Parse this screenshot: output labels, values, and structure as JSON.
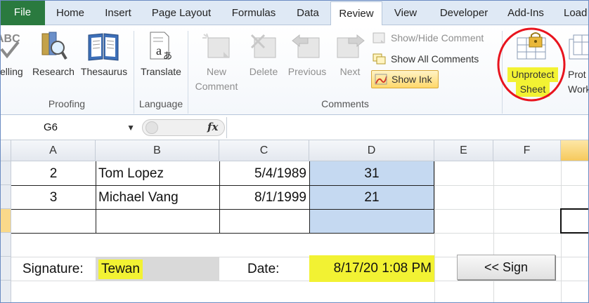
{
  "tabs": [
    "File",
    "Home",
    "Insert",
    "Page Layout",
    "Formulas",
    "Data",
    "Review",
    "View",
    "Developer",
    "Add-Ins",
    "Load"
  ],
  "ribbon": {
    "proofing": {
      "spelling_label": "elling",
      "research_label": "Research",
      "thesaurus_label": "Thesaurus",
      "group_label": "Proofing"
    },
    "language": {
      "translate_label": "Translate",
      "group_label": "Language"
    },
    "comments": {
      "new_comment_line1": "New",
      "new_comment_line2": "Comment",
      "delete_label": "Delete",
      "previous_label": "Previous",
      "next_label": "Next",
      "show_hide_label": "Show/Hide Comment",
      "show_all_label": "Show All Comments",
      "show_ink_label": "Show Ink",
      "group_label": "Comments"
    },
    "changes": {
      "unprotect_line1": "Unprotect",
      "unprotect_line2": "Sheet",
      "protect_line1": "Prot",
      "protect_line2": "Workb"
    }
  },
  "formula_bar": {
    "name_box": "G6",
    "fx_label": "fx",
    "formula": ""
  },
  "sheet": {
    "columns": [
      "A",
      "B",
      "C",
      "D",
      "E",
      "F"
    ],
    "rows": [
      {
        "a": "2",
        "b": "Tom Lopez",
        "c": "5/4/1989",
        "d": "31"
      },
      {
        "a": "3",
        "b": "Michael Vang",
        "c": "8/1/1999",
        "d": "21"
      }
    ],
    "signature_label": "Signature:",
    "signature_value": "Tewan",
    "date_label": "Date:",
    "date_value": "8/17/20 1:08 PM",
    "sign_button_label": "<< Sign"
  },
  "colors": {
    "file_tab": "#2a7a3f",
    "highlight_yellow": "#f2f233",
    "annotation_red": "#e8141e",
    "selected_blue": "#c5d9f1",
    "signature_gray": "#d9d9d9"
  }
}
